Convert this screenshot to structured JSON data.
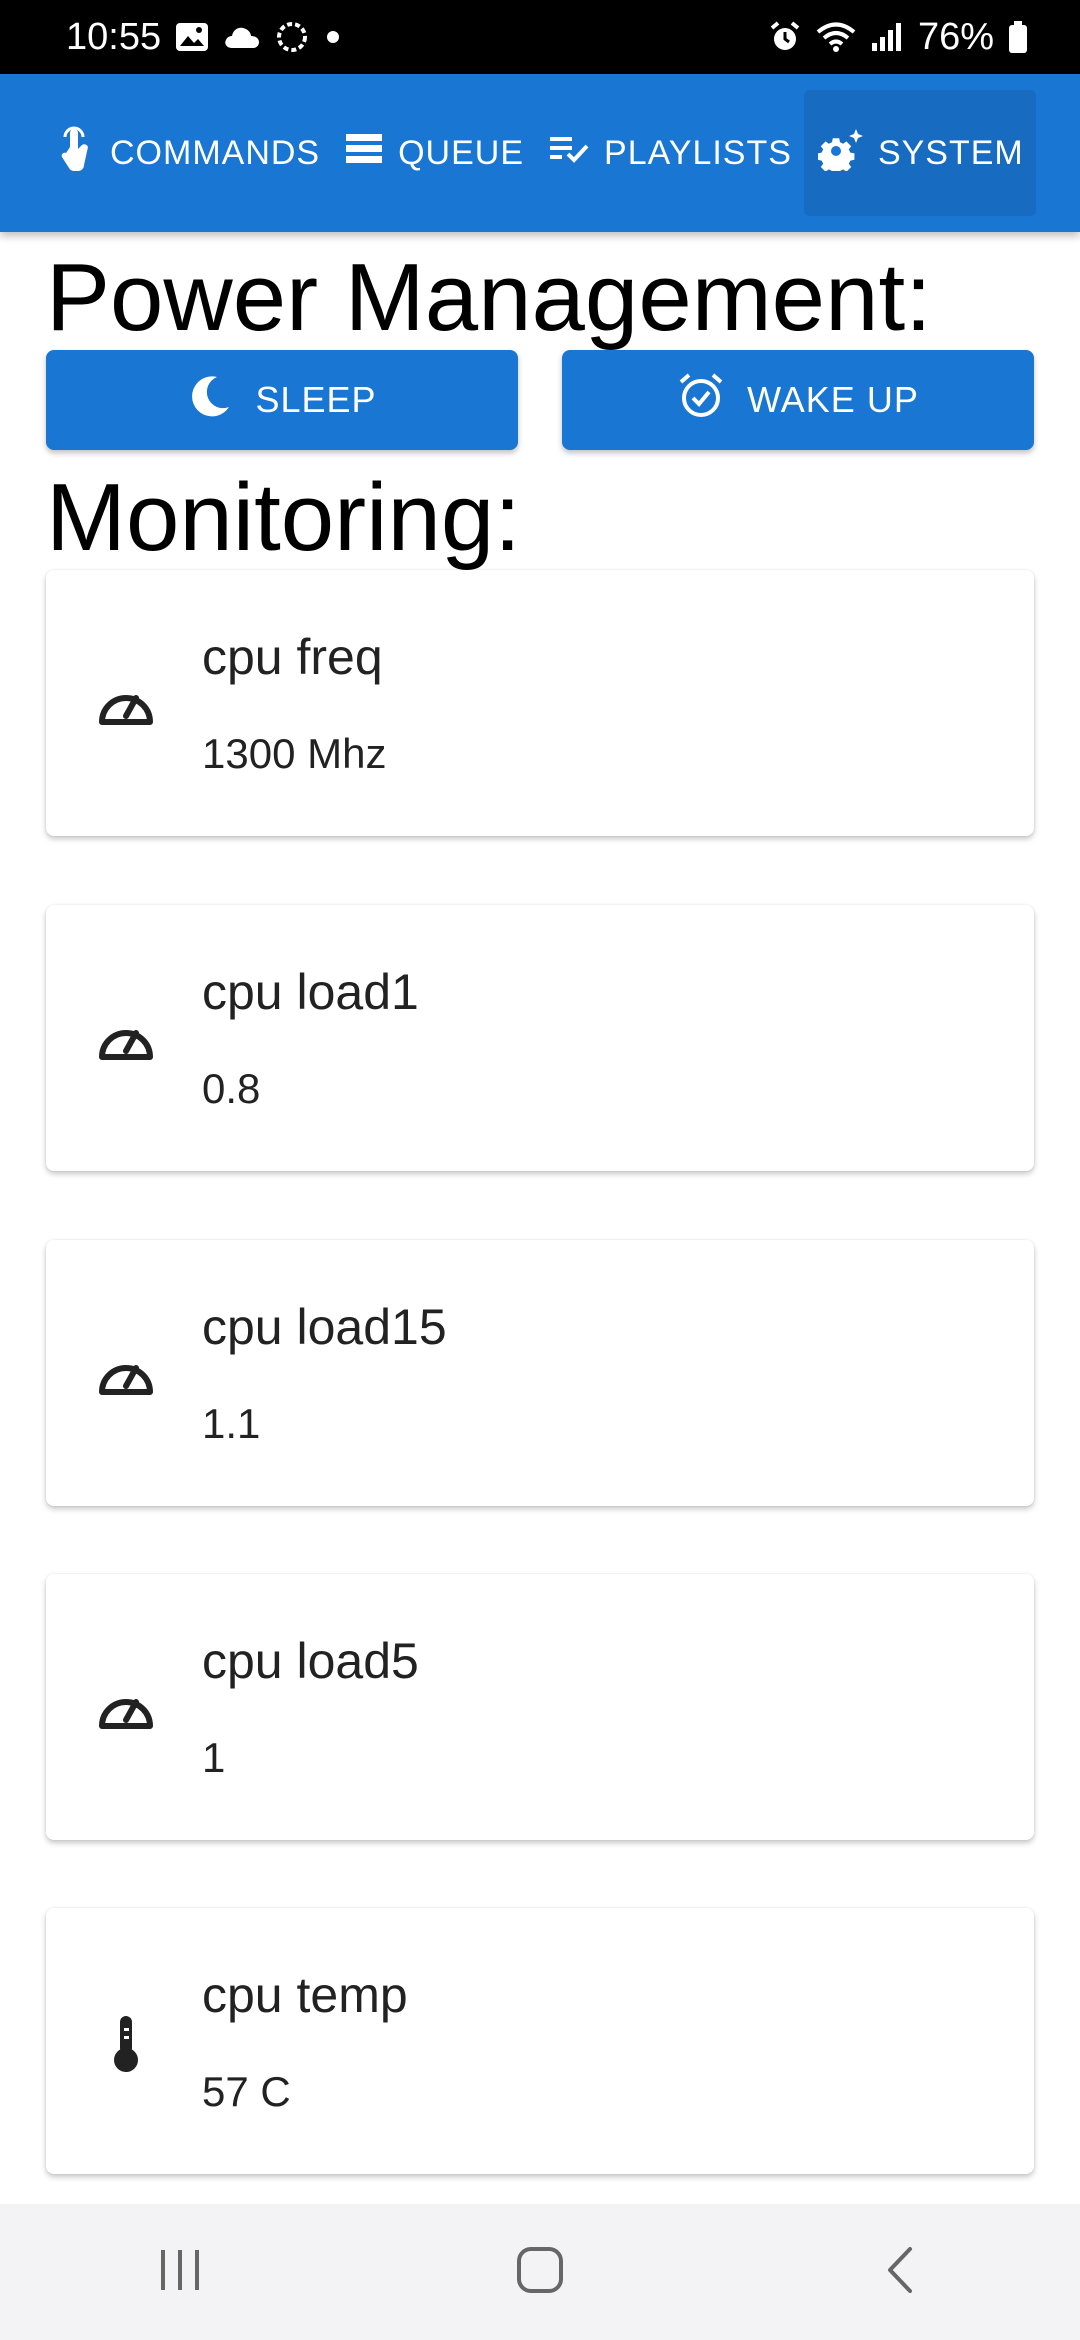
{
  "status_bar": {
    "time": "10:55",
    "battery": "76%",
    "left_icons": [
      "image-icon",
      "cloud-icon",
      "signal-app-icon",
      "dot-icon"
    ],
    "right_icons": [
      "alarm-icon",
      "wifi-icon",
      "cell-signal-icon",
      "battery-icon"
    ]
  },
  "tabs": [
    {
      "label": "COMMANDS",
      "icon": "touch-icon"
    },
    {
      "label": "QUEUE",
      "icon": "queue-icon"
    },
    {
      "label": "PLAYLISTS",
      "icon": "playlist-check-icon"
    },
    {
      "label": "SYSTEM",
      "icon": "gear-icon",
      "active": true
    }
  ],
  "power": {
    "title": "Power Management:",
    "sleep_label": "SLEEP",
    "wake_label": "WAKE UP"
  },
  "monitoring": {
    "title": "Monitoring:",
    "cards": [
      {
        "title": "cpu freq",
        "value": "1300 Mhz",
        "icon": "speedometer-icon"
      },
      {
        "title": "cpu load1",
        "value": "0.8",
        "icon": "speedometer-icon"
      },
      {
        "title": "cpu load15",
        "value": "1.1",
        "icon": "speedometer-icon"
      },
      {
        "title": "cpu load5",
        "value": "1",
        "icon": "speedometer-icon"
      },
      {
        "title": "cpu temp",
        "value": "57 C",
        "icon": "thermometer-icon"
      }
    ]
  },
  "colors": {
    "primary": "#1976d2",
    "status_bar": "#000000",
    "nav_bar": "#f3f3f5"
  }
}
